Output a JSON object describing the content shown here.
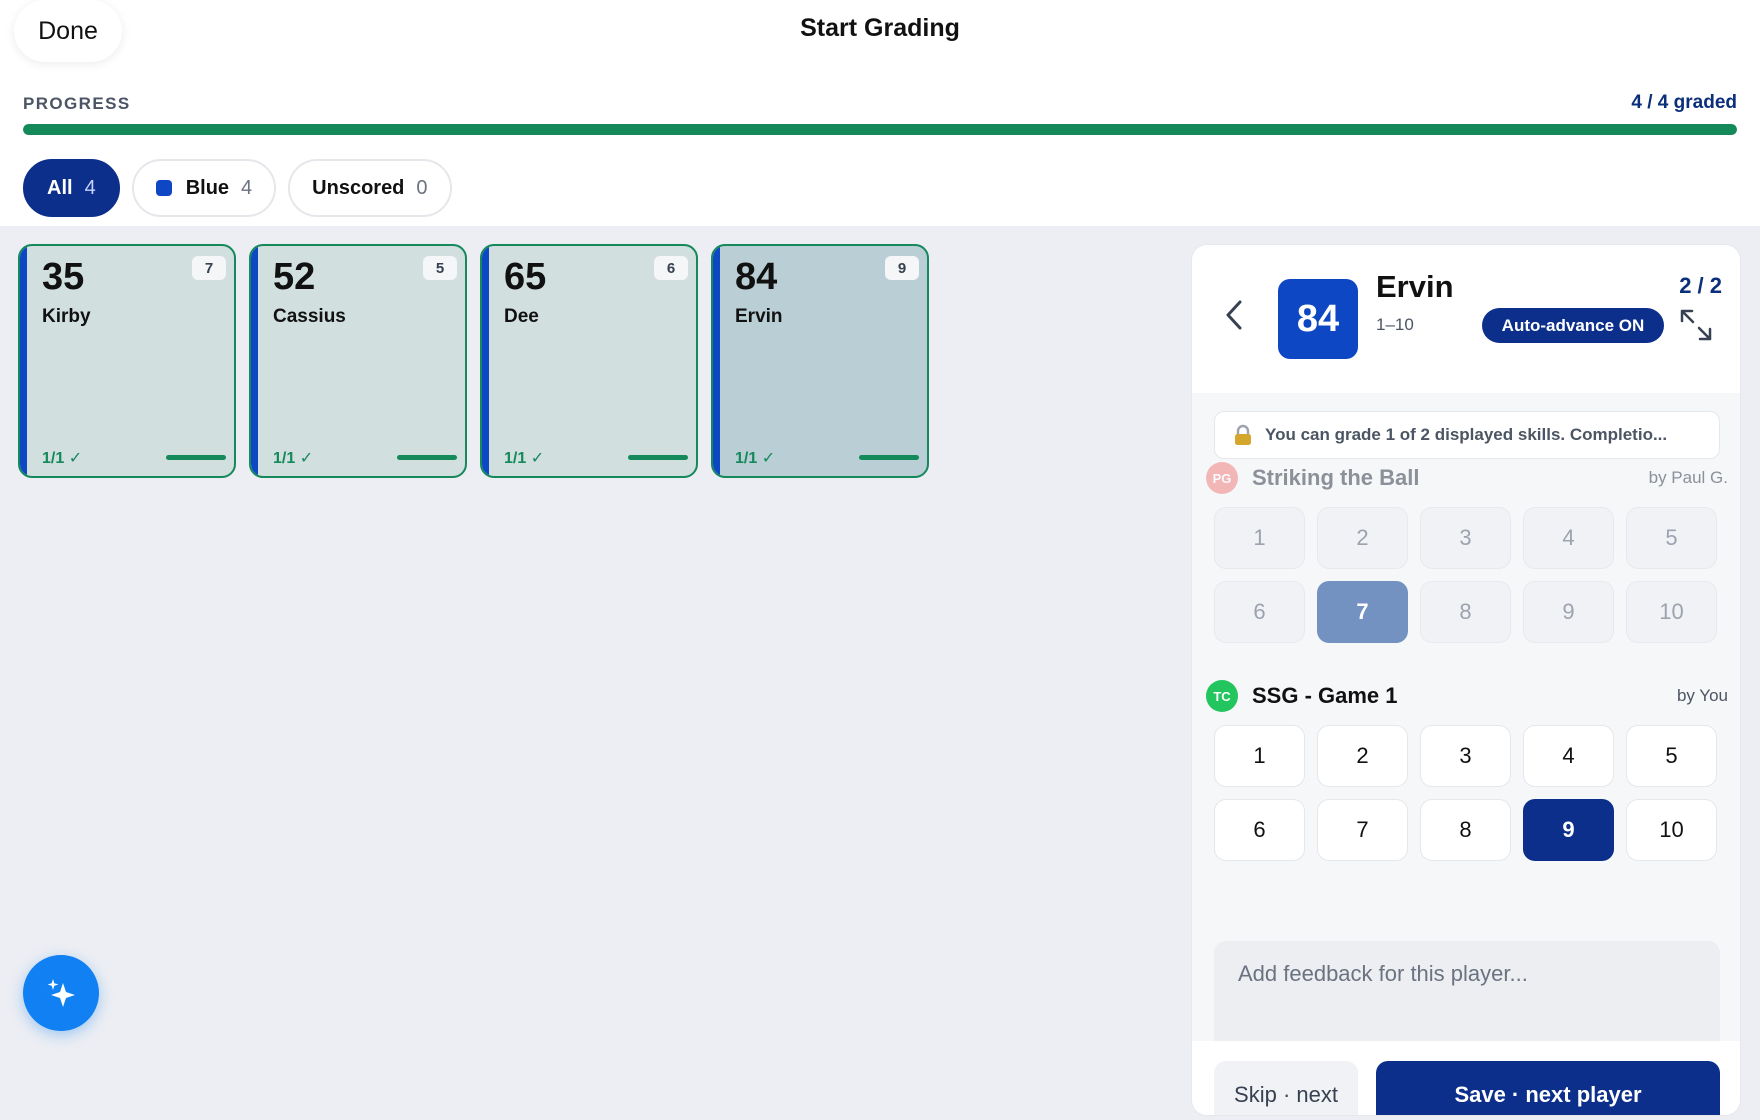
{
  "header": {
    "done_label": "Done",
    "title": "Start Grading",
    "progress_label": "PROGRESS",
    "progress_count": "4 / 4 graded",
    "progress_fraction": 1.0,
    "progress_color": "#14895a"
  },
  "filters": [
    {
      "label": "All",
      "count": "4",
      "active": true
    },
    {
      "label": "Blue",
      "count": "4",
      "color": "#0d47c4"
    },
    {
      "label": "Unscored",
      "count": "0"
    }
  ],
  "players": [
    {
      "number": "35",
      "name": "Kirby",
      "badge": "7",
      "status": "1/1 ✓"
    },
    {
      "number": "52",
      "name": "Cassius",
      "badge": "5",
      "status": "1/1 ✓"
    },
    {
      "number": "65",
      "name": "Dee",
      "badge": "6",
      "status": "1/1 ✓"
    },
    {
      "number": "84",
      "name": "Ervin",
      "badge": "9",
      "status": "1/1 ✓",
      "selected": true
    }
  ],
  "panel": {
    "player_number": "84",
    "player_name": "Ervin",
    "range": "1–10",
    "position": "2 / 2",
    "auto_advance": "Auto-advance ON",
    "notice": "You can grade 1 of 2 displayed skills. Completio...",
    "skills": [
      {
        "initials": "PG",
        "avatar_color": "#f28b8b",
        "name": "Striking the Ball",
        "by": "by Paul G.",
        "scores": [
          "1",
          "2",
          "3",
          "4",
          "5",
          "6",
          "7",
          "8",
          "9",
          "10"
        ],
        "selected": "7",
        "disabled": true
      },
      {
        "initials": "TC",
        "avatar_color": "#22c55e",
        "name": "SSG - Game 1",
        "by": "by You",
        "scores": [
          "1",
          "2",
          "3",
          "4",
          "5",
          "6",
          "7",
          "8",
          "9",
          "10"
        ],
        "selected": "9",
        "disabled": false
      }
    ],
    "feedback_placeholder": "Add feedback for this player...",
    "skip_label": "Skip · next",
    "save_label": "Save · next player"
  },
  "icons": {
    "back": "chevron-left-icon",
    "expand": "expand-icon",
    "lock": "lock-icon",
    "fab": "sparkle-icon"
  }
}
